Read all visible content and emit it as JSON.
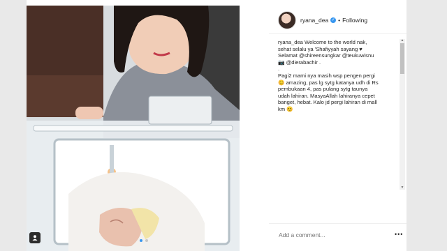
{
  "post": {
    "username": "ryana_dea",
    "separator": "•",
    "follow_label": "Following",
    "caption_lines": [
      "ryana_dea Welcome to the world nak,",
      "sehat selalu ya 'Shafiyyah sayang ♥",
      "Selamat @shireensungkar @teukuwisnu",
      "📷 @dierabachir .",
      ".",
      "Pagi2 mami nya masih wsp pengen pergi",
      "😊 amazing, pas lg sytg katanya udh di Rs",
      "pembukaan 4, pas pulang sytg taunya",
      "udah lahiran. MasyaAllah lahiranya cepet",
      "banget, hebat. Kalo jd pergi lahiran di mall",
      "km 😊"
    ],
    "comment_placeholder": "Add a comment...",
    "more_label": "•••"
  },
  "icons": {
    "verified": "verified-badge-icon",
    "tag": "person-tag-icon",
    "more": "more-options-icon"
  },
  "colors": {
    "accent": "#3897f0",
    "text": "#262626",
    "muted": "#999999"
  }
}
